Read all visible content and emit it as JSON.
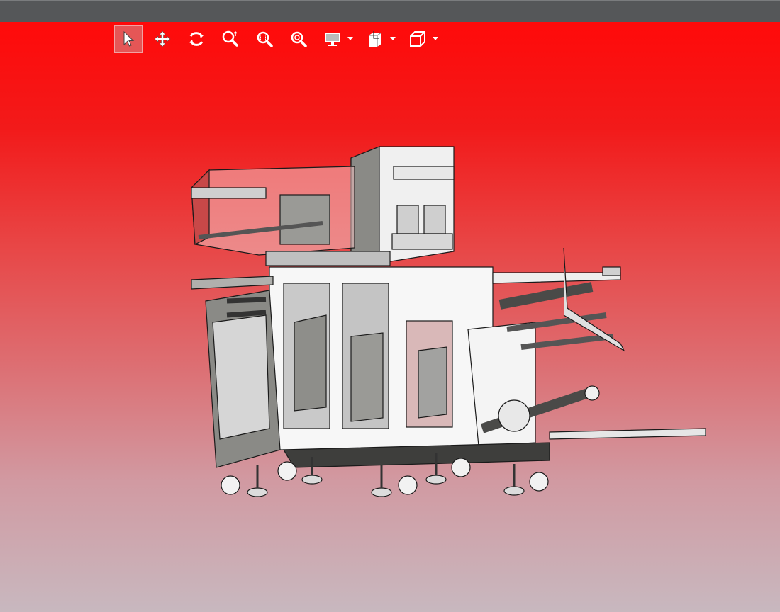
{
  "window": {
    "title": ""
  },
  "toolbar": {
    "tools": [
      {
        "id": "select",
        "icon": "select-arrow-icon",
        "active": true
      },
      {
        "id": "pan",
        "icon": "pan-move-icon",
        "active": false
      },
      {
        "id": "rotate",
        "icon": "rotate-icon",
        "active": false
      },
      {
        "id": "zoom",
        "icon": "zoom-icon",
        "active": false
      },
      {
        "id": "zoom-window",
        "icon": "zoom-window-icon",
        "active": false
      },
      {
        "id": "zoom-fit",
        "icon": "zoom-fit-icon",
        "active": false
      },
      {
        "id": "display",
        "icon": "display-monitor-icon",
        "active": false,
        "dropdown": true
      },
      {
        "id": "section",
        "icon": "section-box-icon",
        "active": false,
        "dropdown": true
      },
      {
        "id": "view-cube",
        "icon": "view-cube-icon",
        "active": false,
        "dropdown": true
      }
    ]
  },
  "viewport": {
    "background_top": "#ff0a0a",
    "background_bottom": "#c8b8bf",
    "model": "3d-machine-assembly"
  },
  "colors": {
    "accent": "#e55656",
    "titlebar": "#555759",
    "icon": "#ffffff"
  }
}
